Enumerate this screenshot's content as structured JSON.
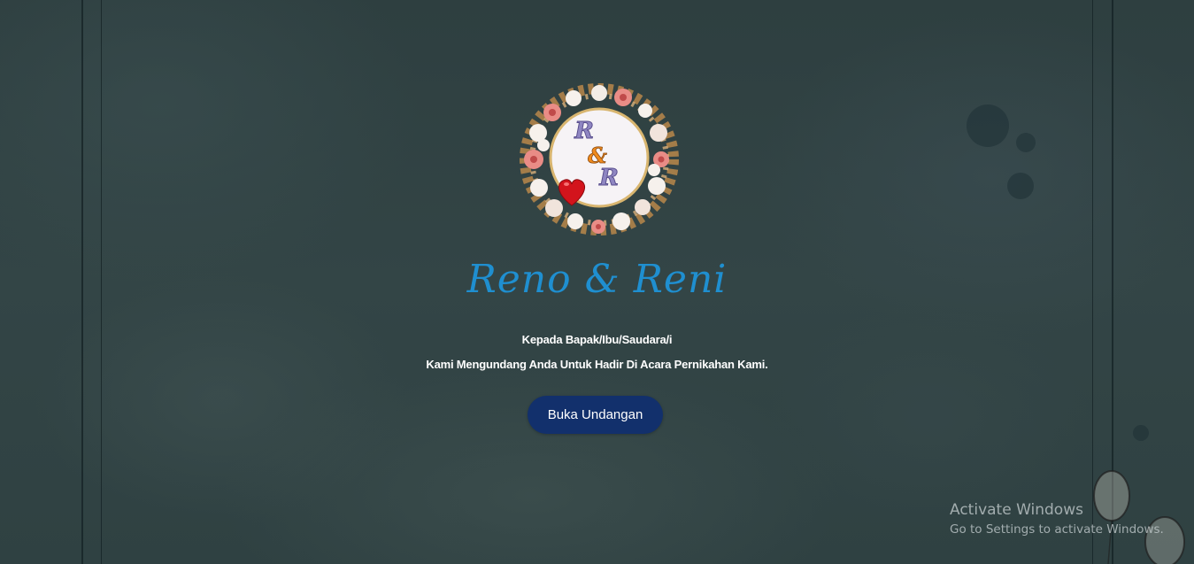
{
  "invitation": {
    "monogram": {
      "letter_top": "R",
      "ampersand": "&",
      "letter_bottom": "R"
    },
    "couple_name": "Reno & Reni",
    "greeting_line1": "Kepada Bapak/Ibu/Saudara/i",
    "greeting_line2": "Kami Mengundang Anda Untuk Hadir Di Acara Pernikahan Kami.",
    "open_button_label": "Buka Undangan",
    "colors": {
      "name": "#1f8fd0",
      "button": "#12306c",
      "background": "#2f4041"
    }
  },
  "os_overlay": {
    "title": "Activate Windows",
    "subtitle": "Go to Settings to activate Windows."
  }
}
